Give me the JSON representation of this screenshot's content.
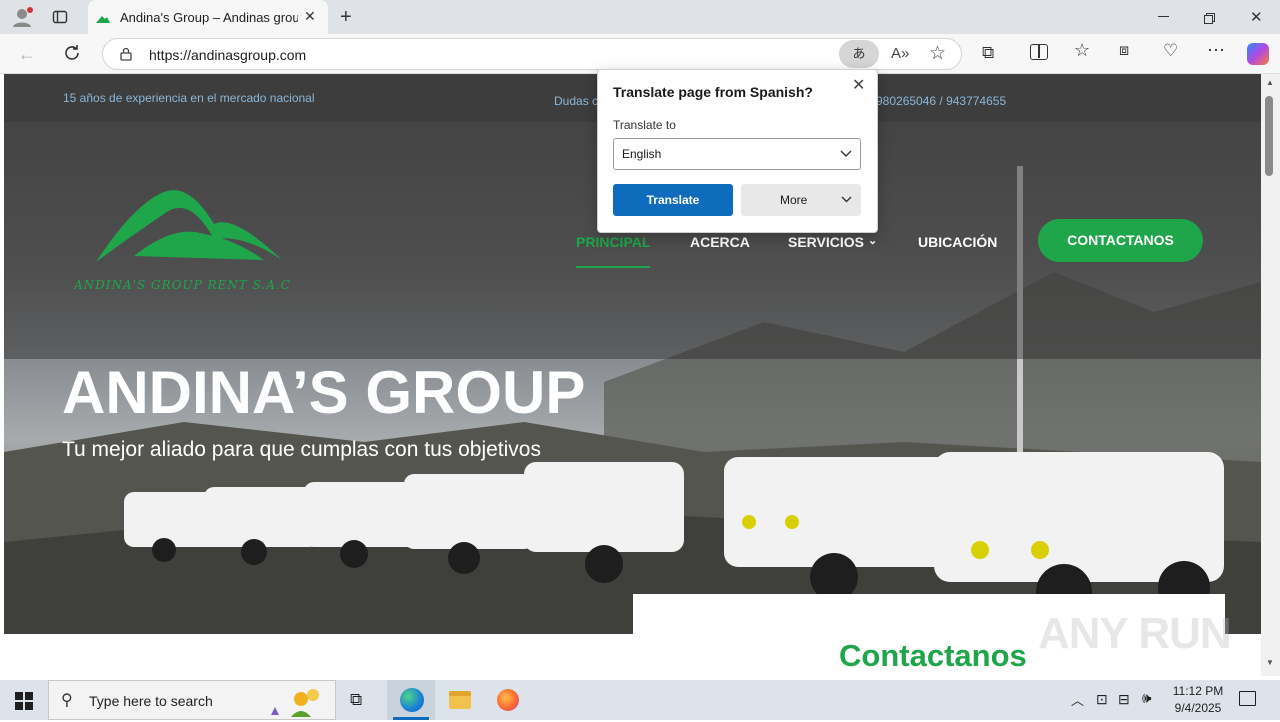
{
  "browser": {
    "tab_title": "Andina's Group – Andinas group.",
    "url": "https://andinasgroup.com"
  },
  "site": {
    "topbar_left": "15 años de experiencia en el mercado nacional",
    "topbar_center": "Dudas c",
    "topbar_phones": "980265046 / 943774655",
    "logo_text": "ANDINA'S GROUP RENT S.A.C",
    "nav": [
      "PRINCIPAL",
      "ACERCA",
      "SERVICIOS",
      "UBICACIÓN"
    ],
    "cta_label": "CONTACTANOS",
    "hero_title": "ANDINA’S GROUP",
    "hero_subtitle": "Tu mejor aliado para que cumplas con tus objetivos",
    "contact_heading": "Contactanos"
  },
  "translate_popup": {
    "title": "Translate page from Spanish?",
    "label": "Translate to",
    "selected_language": "English",
    "translate_button": "Translate",
    "more_button": "More"
  },
  "taskbar": {
    "search_placeholder": "Type here to search",
    "time": "11:12 PM",
    "date": "9/4/2025"
  },
  "watermark": "ANY RUN",
  "colors": {
    "brand_green": "#1fa64a",
    "translate_blue": "#0f6cbd"
  }
}
